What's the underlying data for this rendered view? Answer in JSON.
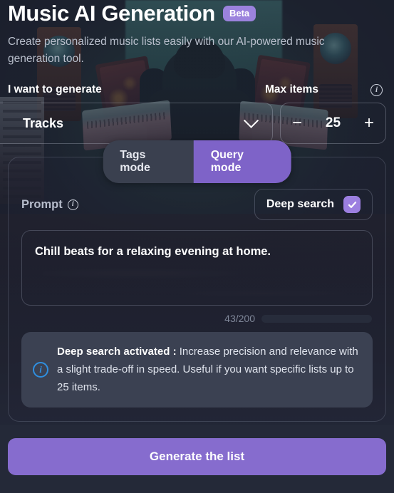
{
  "header": {
    "title": "Music AI Generation",
    "badge": "Beta",
    "subtitle": "Create personalized music lists easily with our AI-powered music generation tool."
  },
  "generate_field": {
    "label": "I want to generate",
    "selected_option": "Tracks",
    "options": [
      "Tracks"
    ],
    "chevron_icon": "chevron-down-icon"
  },
  "max_items": {
    "label": "Max items",
    "info_icon": "info-icon",
    "value": "25",
    "decrement_label": "−",
    "increment_label": "+"
  },
  "mode_toggle": {
    "tags_label": "Tags mode",
    "query_label": "Query mode",
    "active": "Query mode"
  },
  "prompt": {
    "label": "Prompt",
    "info_icon": "info-icon",
    "value": "Chill beats for a relaxing evening at home.",
    "placeholder": "Chill beats for a relaxing evening at home.",
    "counter": "43/200",
    "used": 43,
    "max": 200
  },
  "deep_search": {
    "label": "Deep search",
    "checked": true,
    "check_icon": "check-icon"
  },
  "callout": {
    "icon": "info-circle-icon",
    "title": "Deep search activated :",
    "body": " Increase precision and relevance with a slight trade-off in speed. Useful if you want specific lists up to 25 items."
  },
  "footer": {
    "generate_label": "Generate the list"
  },
  "colors": {
    "accent_purple": "#866cce",
    "toggle_active": "#7e63c8",
    "badge_purple": "#9b82dd",
    "checkbox_purple": "#9c7fe0",
    "progress_purple": "#a086e6",
    "info_blue": "#2f8fe0",
    "page_bg": "#232838",
    "callout_bg": "#3b4152"
  }
}
